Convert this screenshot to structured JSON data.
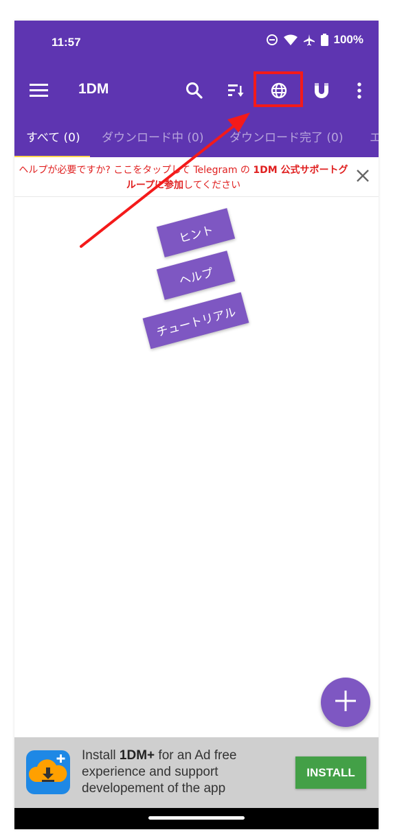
{
  "status_bar": {
    "time": "11:57",
    "battery": "100%"
  },
  "toolbar": {
    "title": "1DM",
    "icons": [
      "menu-icon",
      "search-icon",
      "sort-icon",
      "browser-globe-icon",
      "magnet-icon",
      "more-vert-icon"
    ]
  },
  "tabs": [
    {
      "label": "すべて (0)",
      "active": true
    },
    {
      "label": "ダウンロード中 (0)",
      "active": false
    },
    {
      "label": "ダウンロード完了 (0)",
      "active": false
    },
    {
      "label": "エ",
      "active": false
    }
  ],
  "notice": {
    "part1": "ヘルプが必要ですか? ここをタップして Telegram の ",
    "bold1": "1DM 公式サポートグループに参加",
    "part2": "してください"
  },
  "chips": {
    "hint": "ヒント",
    "help": "ヘルプ",
    "tutorial": "チュートリアル"
  },
  "ad": {
    "text_pre": "Install ",
    "text_bold": "1DM+",
    "text_post": " for an Ad free experience and support developement of the app",
    "install_label": "INSTALL"
  },
  "colors": {
    "appbar": "#5e35b1",
    "chip": "#7e57c2",
    "notice_text": "#e02020",
    "install": "#43a047",
    "annotation": "#f41a1a"
  }
}
